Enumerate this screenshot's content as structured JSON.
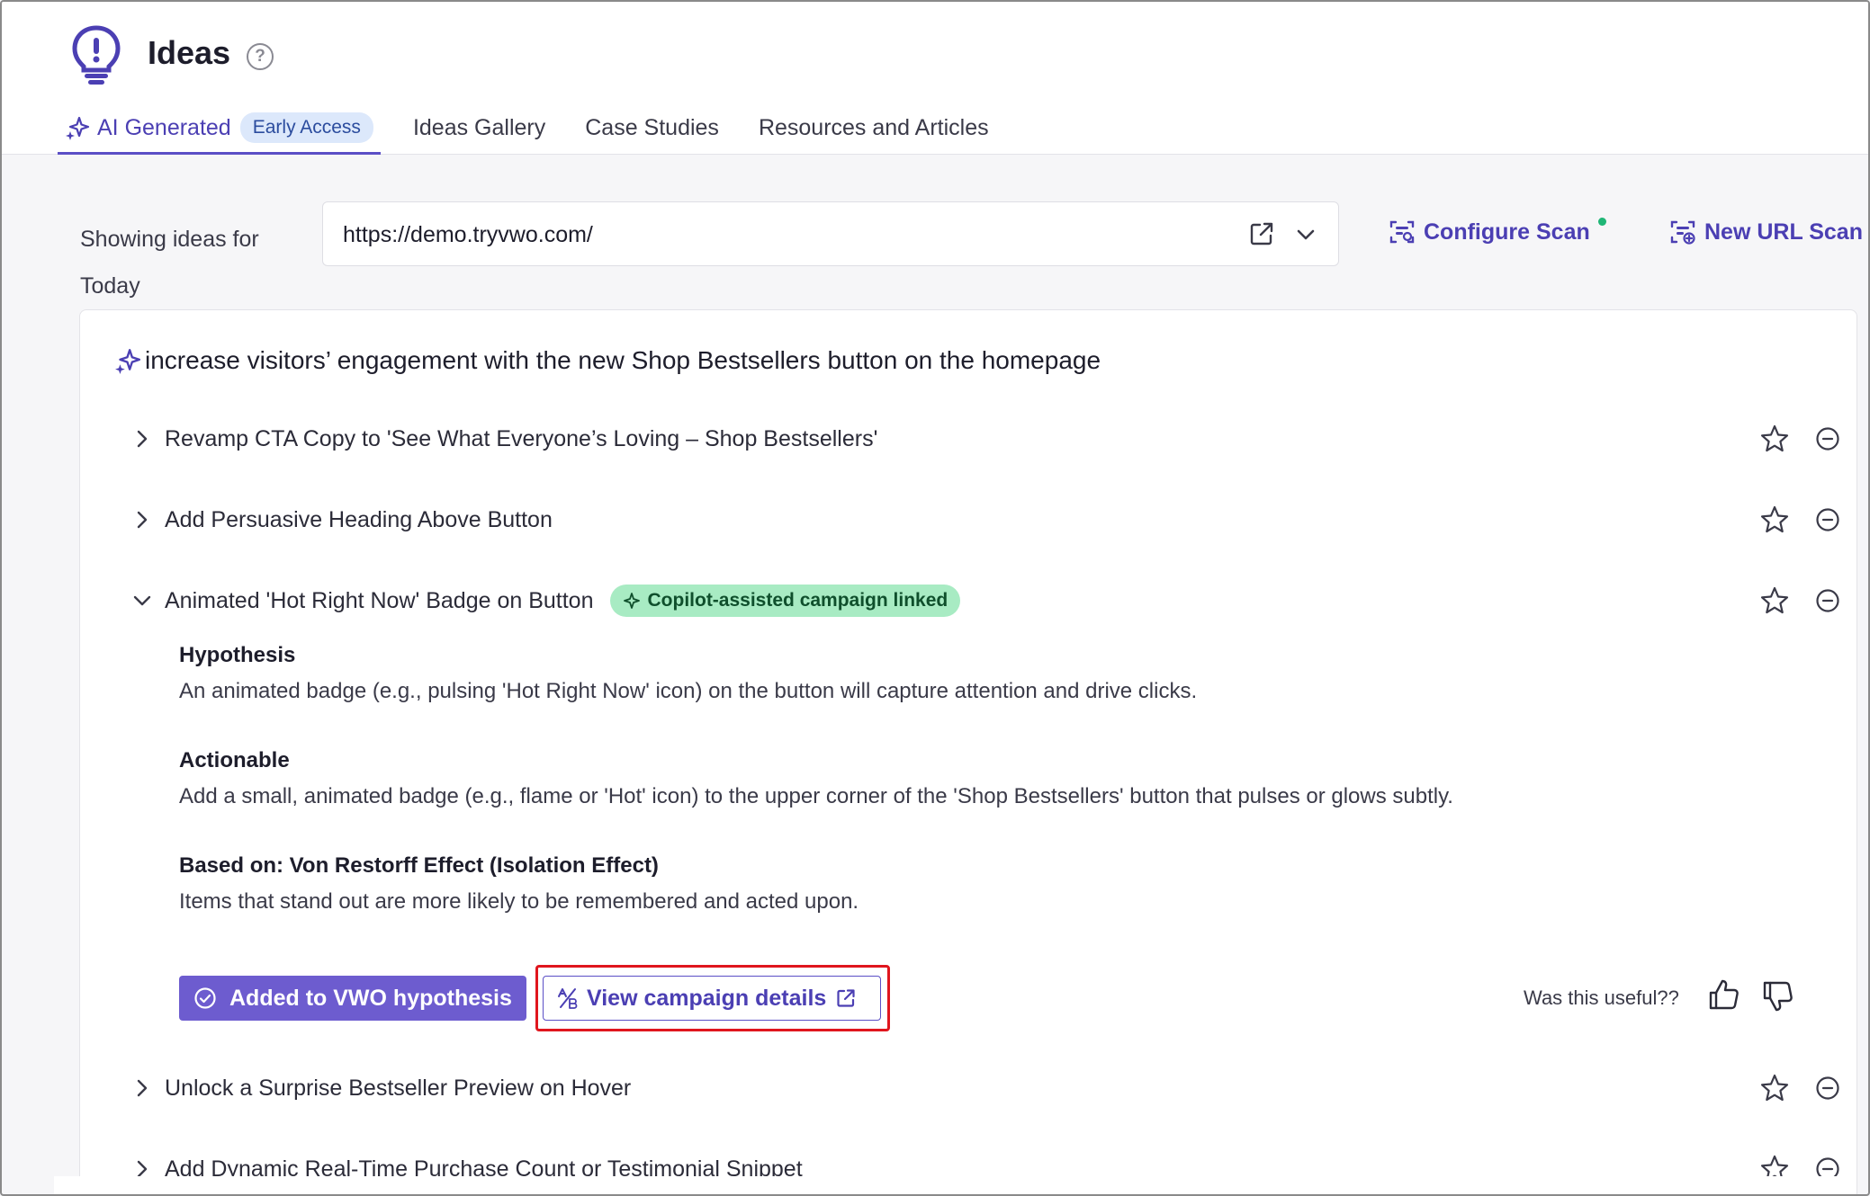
{
  "header": {
    "title": "Ideas",
    "help_symbol": "?"
  },
  "tabs": [
    {
      "label": "AI Generated",
      "badge": "Early Access"
    },
    {
      "label": "Ideas Gallery"
    },
    {
      "label": "Case Studies"
    },
    {
      "label": "Resources and Articles"
    }
  ],
  "toolbar": {
    "showing_label": "Showing ideas for Today",
    "url": "https://demo.tryvwo.com/",
    "configure_scan": "Configure Scan",
    "new_url_scan": "New URL Scan"
  },
  "goal": {
    "title": "increase visitors’ engagement with the new Shop Bestsellers button on the homepage"
  },
  "ideas": [
    {
      "label": "Revamp CTA Copy to 'See What Everyone’s Loving – Shop Bestsellers'",
      "expanded": false
    },
    {
      "label": "Add Persuasive Heading Above Button",
      "expanded": false
    },
    {
      "label": "Animated 'Hot Right Now' Badge on Button",
      "expanded": true,
      "badge": "Copilot-assisted campaign linked"
    },
    {
      "label": "Unlock a Surprise Bestseller Preview on Hover",
      "expanded": false
    },
    {
      "label": "Add Dynamic Real-Time Purchase Count or Testimonial Snippet",
      "expanded": false
    }
  ],
  "expanded_idea": {
    "hypothesis_heading": "Hypothesis",
    "hypothesis_text": "An animated badge (e.g., pulsing 'Hot Right Now' icon) on the button will capture attention and drive clicks.",
    "actionable_heading": "Actionable",
    "actionable_text": "Add a small, animated badge (e.g., flame or 'Hot' icon) to the upper corner of the 'Shop Bestsellers' button that pulses or glows subtly.",
    "based_on_heading": "Based on: Von Restorff Effect (Isolation Effect)",
    "based_on_text": "Items that stand out are more likely to be remembered and acted upon.",
    "added_button": "Added to VWO hypothesis",
    "view_button": "View campaign details",
    "useful_question": "Was this useful??"
  },
  "colors": {
    "accent": "#5b4fc6",
    "highlight": "#e0161e",
    "badge_green": "#a8ebc3"
  }
}
